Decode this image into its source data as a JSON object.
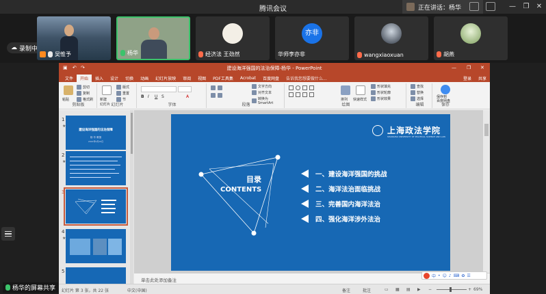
{
  "window": {
    "title": "腾讯会议",
    "speaking_label": "正在讲话：杨华"
  },
  "recording": {
    "label": "录制中"
  },
  "participants": [
    {
      "name": "吴惟予",
      "mic": "on"
    },
    {
      "name": "杨华",
      "mic": "active"
    },
    {
      "name": "经济法 王劲然",
      "mic": "off"
    },
    {
      "name": "华师李亦非",
      "mic": "off",
      "avatar_text": "亦非",
      "avatar_color": "#1a73e8"
    },
    {
      "name": "wangxiaoxuan",
      "mic": "off"
    },
    {
      "name": "胡燕",
      "mic": "off"
    }
  ],
  "ppt": {
    "title": "建设海洋强国的法治保障-杨华 - PowerPoint",
    "menu": [
      "文件",
      "开始",
      "插入",
      "设计",
      "切换",
      "动画",
      "幻灯片放映",
      "审阅",
      "视图",
      "PDF工具集",
      "Acrobat",
      "百度网盘"
    ],
    "active_menu": "开始",
    "tell_me": "告诉我您想要做什么...",
    "login": "登录",
    "share": "共享",
    "ribbon_groups": [
      "剪贴板",
      "幻灯片",
      "字体",
      "段落",
      "绘图",
      "编辑",
      "保存"
    ],
    "ribbon": {
      "paste": "粘贴",
      "cut": "剪切",
      "copy": "复制",
      "format_painter": "格式刷",
      "new_slide": "新建\n幻灯片",
      "layout": "版式",
      "reset": "重置",
      "section": "节",
      "text_direction": "文字方向",
      "align_text": "对齐文本",
      "smartart": "转换为 SmartArt",
      "arrange": "排列",
      "quick_styles": "快速样式",
      "shape_fill": "形状填充",
      "shape_outline": "形状轮廓",
      "shape_effects": "形状效果",
      "find": "查找",
      "replace": "替换",
      "select": "选择",
      "save_baidu": "保存到\n百度网盘"
    },
    "thumbnails": [
      {
        "num": "1",
        "title": "建设海洋强国的法治保障",
        "author": "杨 华 教授",
        "date": "2022年5月10日"
      },
      {
        "num": "2"
      },
      {
        "num": "3"
      },
      {
        "num": "4"
      },
      {
        "num": "5"
      }
    ],
    "selected_slide": 3,
    "slide": {
      "logo_cn": "上海政法学院",
      "logo_en": "SHANGHAI UNIVERSITY OF POLITICAL SCIENCE AND LAW",
      "heading_cn": "目录",
      "heading_en": "CONTENTS",
      "items": [
        "一、建设海洋强国的挑战",
        "二、海洋法治面临挑战",
        "三、完善国内海洋法治",
        "四、强化海洋涉外法治"
      ]
    },
    "notes_placeholder": "单击此处添加备注",
    "status": {
      "slide_count": "幻灯片 第 3 张，共 22 张",
      "language": "中文(中国)",
      "notes": "备注",
      "comments": "批注",
      "zoom": "69%"
    },
    "ime": "中"
  },
  "share_label": "杨华的屏幕共享"
}
